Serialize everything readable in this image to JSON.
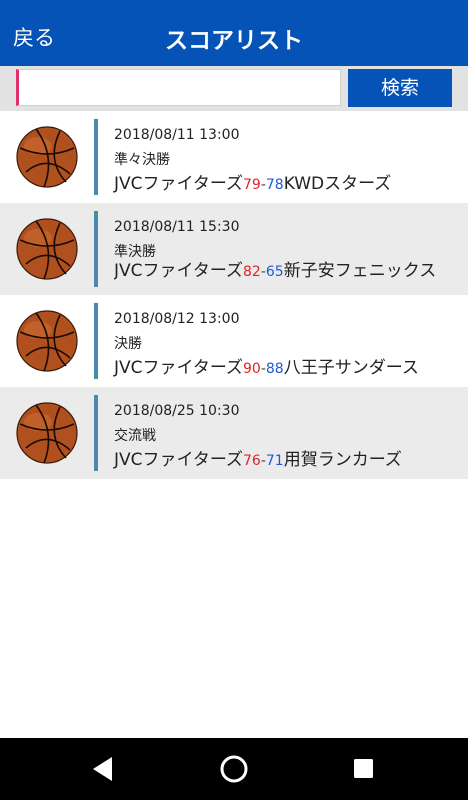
{
  "header": {
    "back_label": "戻る",
    "title": "スコアリスト"
  },
  "search": {
    "value": "",
    "placeholder": "",
    "button_label": "検索"
  },
  "scores": [
    {
      "icon": "basketball-icon",
      "datetime": "2018/08/11 13:00",
      "round": "準々決勝",
      "home_team": "JVCファイターズ",
      "home_score": "79",
      "separator": "-",
      "away_score": "78",
      "away_team": "KWDスターズ"
    },
    {
      "icon": "basketball-icon",
      "datetime": "2018/08/11 15:30",
      "round": "準決勝",
      "home_team": "JVCファイターズ",
      "home_score": "82",
      "separator": "-",
      "away_score": "65",
      "away_team": "新子安フェニックス"
    },
    {
      "icon": "basketball-icon",
      "datetime": "2018/08/12 13:00",
      "round": "決勝",
      "home_team": "JVCファイターズ",
      "home_score": "90",
      "separator": "-",
      "away_score": "88",
      "away_team": "八王子サンダース"
    },
    {
      "icon": "basketball-icon",
      "datetime": "2018/08/25 10:30",
      "round": "交流戦",
      "home_team": "JVCファイターズ",
      "home_score": "76",
      "separator": "-",
      "away_score": "71",
      "away_team": "用賀ランカーズ"
    }
  ],
  "navbar": {
    "back_icon": "triangle-back-icon",
    "home_icon": "circle-home-icon",
    "recent_icon": "square-recents-icon"
  },
  "colors": {
    "header_bg": "#0653b7",
    "home_score": "#e0242a",
    "away_score": "#1e5ad8",
    "divider": "#4a8aa8"
  }
}
